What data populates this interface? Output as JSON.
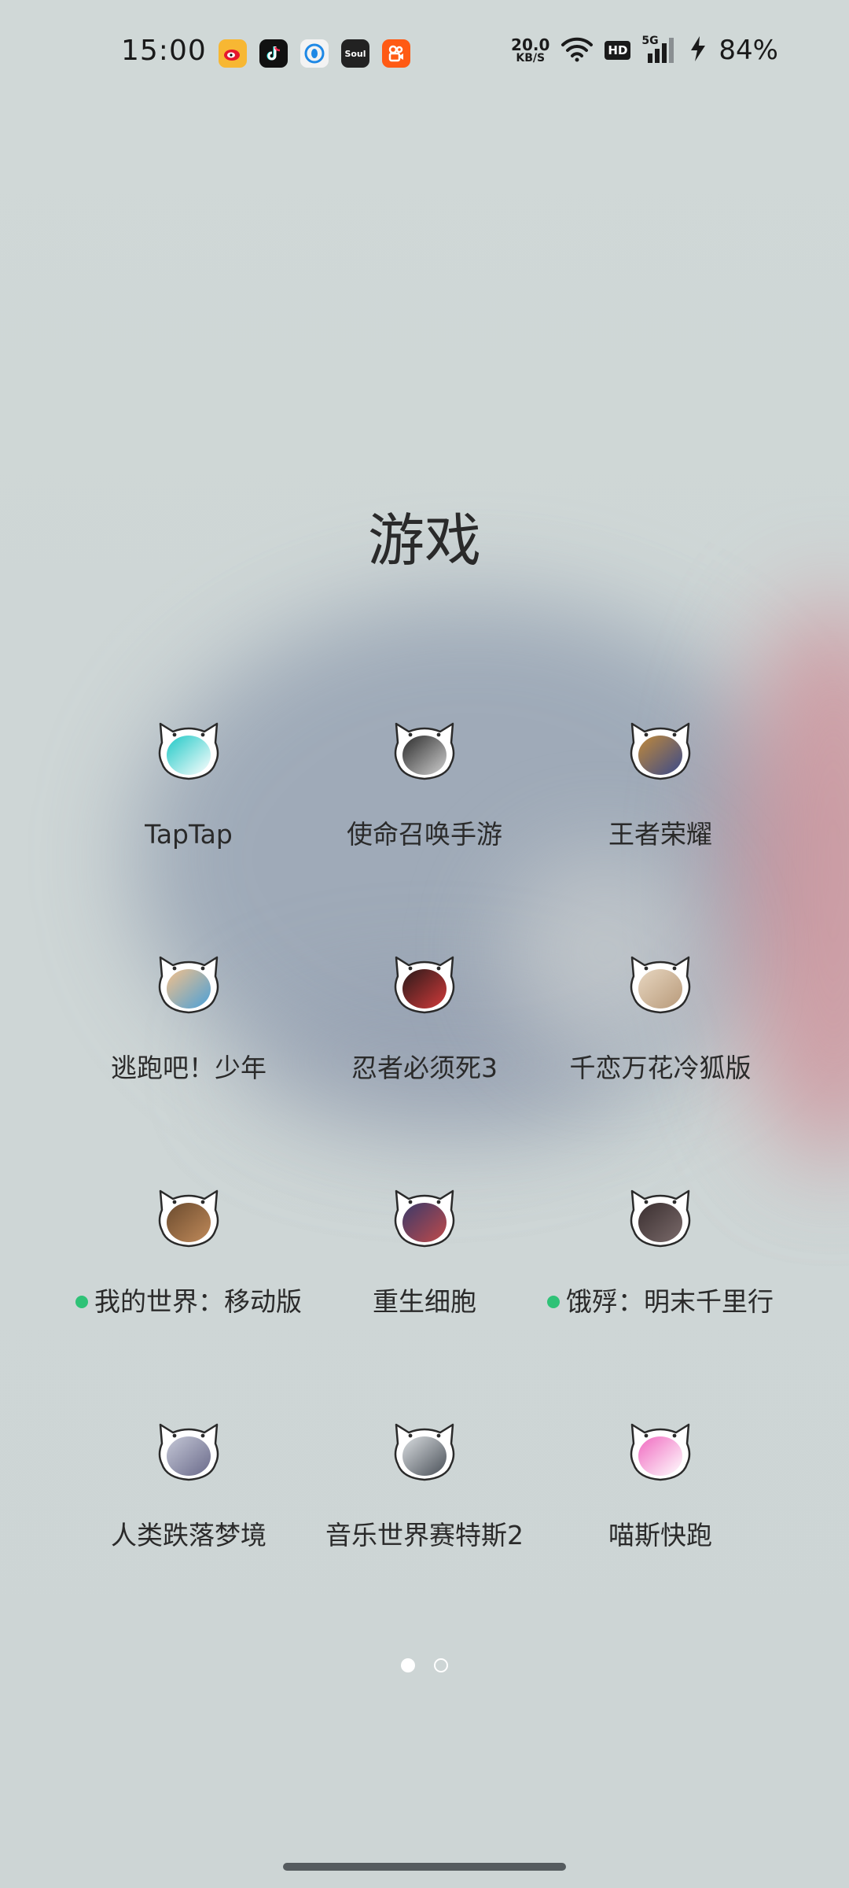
{
  "status_bar": {
    "time": "15:00",
    "notification_icons": [
      "weibo-icon",
      "tiktok-icon",
      "qq-icon",
      "soul-icon",
      "kuaishou-icon"
    ],
    "soul_label": "Soul",
    "net_speed_value": "20.0",
    "net_speed_unit": "KB/S",
    "hd_badge": "HD",
    "network_type": "5G",
    "battery_percent": "84%"
  },
  "folder": {
    "title": "游戏",
    "apps": [
      {
        "label": "TapTap",
        "icon": "taptap-icon",
        "colors": [
          "#1fc8c6",
          "#ffffff"
        ],
        "badge": false
      },
      {
        "label": "使命召唤手游",
        "icon": "call-of-duty-icon",
        "colors": [
          "#2b2b2b",
          "#cfcfcf"
        ],
        "badge": false
      },
      {
        "label": "王者荣耀",
        "icon": "honor-of-kings-icon",
        "colors": [
          "#c0893a",
          "#3a4a8a"
        ],
        "badge": false
      },
      {
        "label": "逃跑吧！少年",
        "icon": "escape-boy-icon",
        "colors": [
          "#f3c08a",
          "#4aa0d8"
        ],
        "badge": false
      },
      {
        "label": "忍者必须死3",
        "icon": "ninja-must-die-icon",
        "colors": [
          "#2a1a1a",
          "#d23a3a"
        ],
        "badge": false
      },
      {
        "label": "千恋万花冷狐版",
        "icon": "senren-banka-icon",
        "colors": [
          "#e7d6c0",
          "#b89a7a"
        ],
        "badge": false
      },
      {
        "label": "我的世界：移动版",
        "icon": "minecraft-icon",
        "colors": [
          "#6b4b2e",
          "#c08a5a"
        ],
        "badge": true
      },
      {
        "label": "重生细胞",
        "icon": "dead-cells-icon",
        "colors": [
          "#3a3a6a",
          "#c04a4a"
        ],
        "badge": false
      },
      {
        "label": "饿殍：明末千里行",
        "icon": "starving-icon",
        "colors": [
          "#3a2f30",
          "#7a6a6a"
        ],
        "badge": true
      },
      {
        "label": "人类跌落梦境",
        "icon": "human-fall-flat-icon",
        "colors": [
          "#c4c7d6",
          "#6a6a8a"
        ],
        "badge": false
      },
      {
        "label": "音乐世界赛特斯2",
        "icon": "cytus-2-icon",
        "colors": [
          "#d9dde0",
          "#4a5058"
        ],
        "badge": false
      },
      {
        "label": "喵斯快跑",
        "icon": "muse-dash-icon",
        "colors": [
          "#f06ac0",
          "#ffffff"
        ],
        "badge": false
      }
    ]
  },
  "page_indicator": {
    "pages": 2,
    "current": 1
  },
  "accent_colors": {
    "badge_dot": "#2fc277",
    "home_bar": "#555b5f"
  }
}
